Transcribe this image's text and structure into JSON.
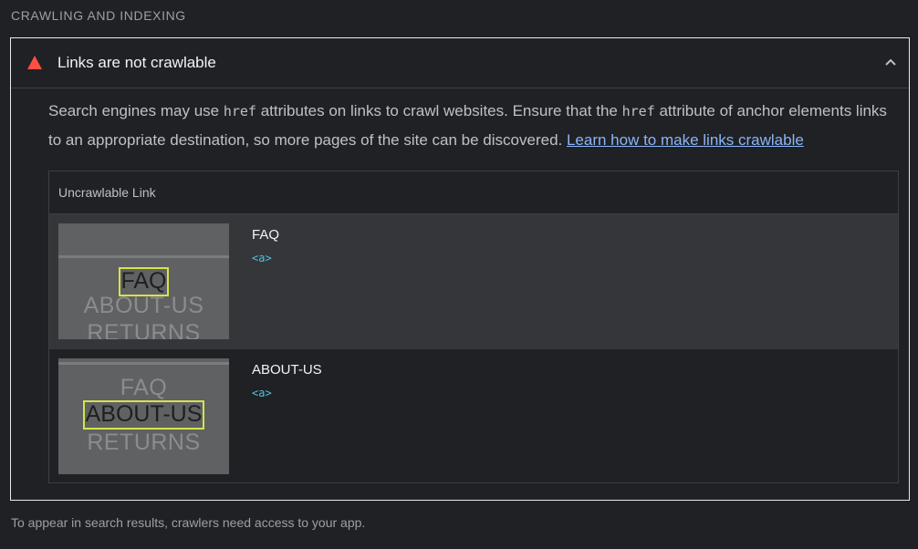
{
  "section": {
    "title": "CRAWLING AND INDEXING"
  },
  "audit": {
    "title": "Links are not crawlable",
    "status_color": "#ff4e42",
    "description": {
      "part1": "Search engines may use ",
      "code1": "href",
      "part2": " attributes on links to crawl websites. Ensure that the ",
      "code2": "href",
      "part3": " attribute of anchor elements links to an appropriate destination, so more pages of the site can be discovered. ",
      "link": "Learn how to make links crawlable"
    },
    "table": {
      "header": "Uncrawlable Link",
      "rows": [
        {
          "label": "FAQ",
          "snippet": "<a>",
          "thumb_lines": [
            "FAQ",
            "ABOUT-US",
            "RETURNS"
          ]
        },
        {
          "label": "ABOUT-US",
          "snippet": "<a>",
          "thumb_lines": [
            "FAQ",
            "ABOUT-US",
            "RETURNS"
          ]
        }
      ]
    }
  },
  "footer": {
    "text": "To appear in search results, crawlers need access to your app."
  }
}
